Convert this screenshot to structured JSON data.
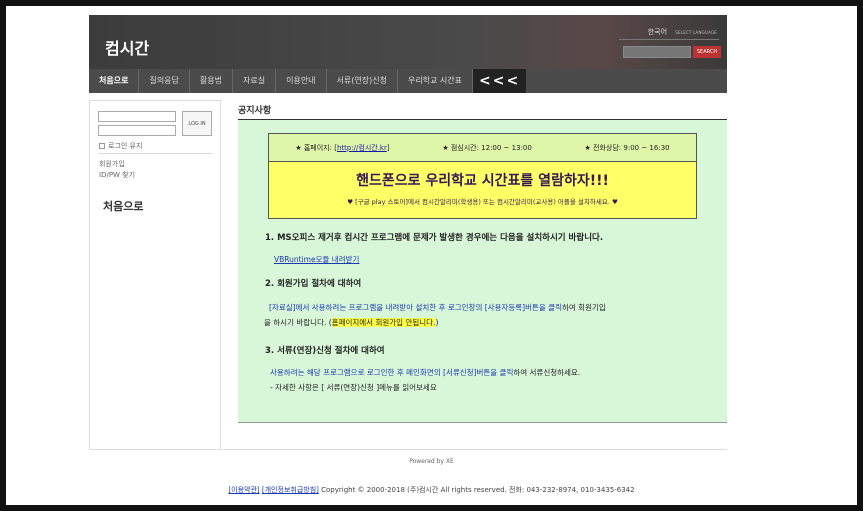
{
  "header": {
    "site_title": "컴시간",
    "lang_label": "한국어",
    "lang_select": "SELECT LANGUAGE",
    "search_button": "SEARCH"
  },
  "nav": {
    "items": [
      "처음으로",
      "질의응답",
      "활용법",
      "자료실",
      "이용안내",
      "서류(연장)신청",
      "우리학교 시간표"
    ],
    "arrows": "<<<"
  },
  "login": {
    "login_button": "LOG IN",
    "keep_login": "로그인 유지",
    "join": "회원가입",
    "find": "ID/PW 찾기"
  },
  "sidebar": {
    "home": "처음으로"
  },
  "content": {
    "title": "공지사항",
    "banner": {
      "homepage_prefix": "★ 홈페이지: [",
      "homepage_link": "http://컴시간.kr",
      "homepage_suffix": "]",
      "hours": "★ 점심시간: 12:00 ~ 13:00",
      "consult": "★ 전화상담: 9:00 ~ 16:30",
      "headline": "핸드폰으로 우리학교 시간표를 열람하자!!!",
      "subline": "♥ [구글 play 스토어]에서 컴시간알리미(학생용) 또는 컴시간알리미(교사용) 어플을 설치하세요. ♥"
    },
    "sec1_head": "1. MS오피스 제거후 컴시간 프로그램에 문제가 발생한 경우에는 다음을 설치하시기 바랍니다.",
    "sec1_link": "VBRuntime모듈 내려받기",
    "sec2_head": "2. 회원가입 절차에 대하여",
    "sec2_line1_blue": "[자료실]에서 사용하려는 프로그램을 내려받아 설치한 후 로그인창의 [사용자등록]버튼을 클릭",
    "sec2_line1_rest": "하여 회원기입",
    "sec2_line2_pre": "을 하시기 바랍니다. (",
    "sec2_line2_hl": "홈페이지에서 회원가입 안됩니다.",
    "sec2_line2_post": ")",
    "sec3_head": "3. 서류(연장)신청 절차에 대하여",
    "sec3_line1_blue": "사용하려는 해당 프로그램으로 로그인한 후 메인화면의 [서류신청]버튼을 클릭",
    "sec3_line1_rest": "하여 서류신청하세요.",
    "sec3_line2": "- 자세한 사항은 [ 서류(연장)신청 ]메뉴를 읽어보세요"
  },
  "footer": {
    "powered": "Powered by XE",
    "terms": "[이용약관]",
    "privacy": "[개인정보취급방침]",
    "copyright": "Copyright © 2000-2018 (주)컴시간 All rights reserved. 전화: 043-232-8974, 010-3435-6342"
  }
}
